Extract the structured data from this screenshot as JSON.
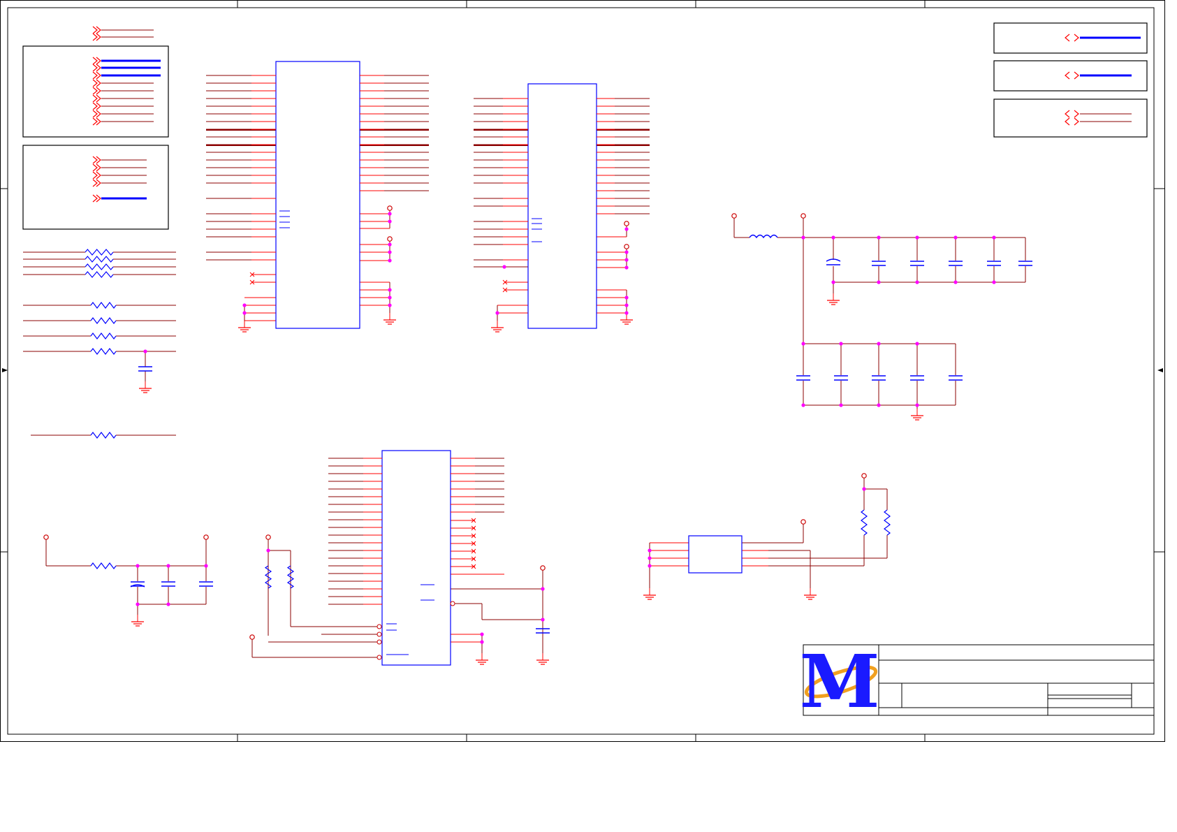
{
  "sheet": {
    "title_block": {
      "logo_letter": "M"
    }
  },
  "colors": {
    "wire": "#8b0000",
    "pin": "#ff0000",
    "component": "#0000ff",
    "junction": "#ff00ff",
    "bus": "#0000ff",
    "power": "#cc0000",
    "frame": "#000000",
    "logo_blue": "#1a1aff",
    "logo_orange": "#f0a020"
  },
  "icons": {
    "offpage_connector": "double-chevron-icon",
    "ground": "ground-icon",
    "power_port": "power-circle-icon",
    "resistor": "resistor-zigzag-icon",
    "capacitor": "capacitor-icon",
    "inductor": "inductor-coil-icon",
    "no_connect": "no-connect-x-icon"
  }
}
